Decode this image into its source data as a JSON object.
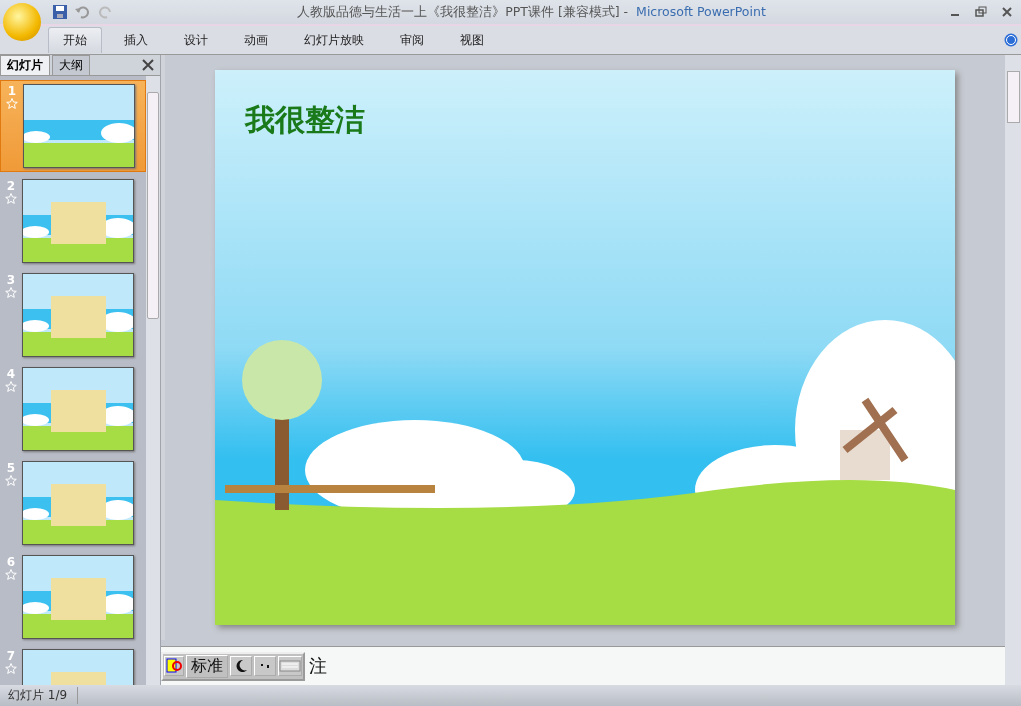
{
  "window": {
    "title": "人教版品德与生活一上《我很整洁》PPT课件 [兼容模式] -",
    "app": "Microsoft PowerPoint"
  },
  "ribbon_tabs": [
    {
      "label": "开始",
      "selected": true
    },
    {
      "label": "插入",
      "selected": false
    },
    {
      "label": "设计",
      "selected": false
    },
    {
      "label": "动画",
      "selected": false
    },
    {
      "label": "幻灯片放映",
      "selected": false
    },
    {
      "label": "审阅",
      "selected": false
    },
    {
      "label": "视图",
      "selected": false
    }
  ],
  "pane_tabs": [
    {
      "label": "幻灯片",
      "selected": true
    },
    {
      "label": "大纲",
      "selected": false
    }
  ],
  "slides": [
    {
      "number": "1",
      "selected": true
    },
    {
      "number": "2",
      "selected": false
    },
    {
      "number": "3",
      "selected": false
    },
    {
      "number": "4",
      "selected": false
    },
    {
      "number": "5",
      "selected": false
    },
    {
      "number": "6",
      "selected": false
    },
    {
      "number": "7",
      "selected": false
    }
  ],
  "slide": {
    "title": "我很整洁"
  },
  "notes": {
    "text": "注"
  },
  "ime": {
    "mode": "标准"
  },
  "status_bar": {
    "text": "幻灯片 1/9"
  }
}
